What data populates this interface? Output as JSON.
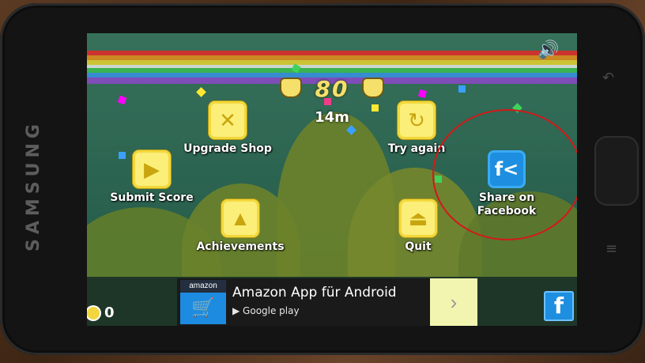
{
  "device": {
    "brand": "SAMSUNG"
  },
  "hud": {
    "score": "80",
    "distance": "14m",
    "coins": "0"
  },
  "menu": {
    "upgrade_shop": "Upgrade Shop",
    "try_again": "Try again",
    "submit_score": "Submit Score",
    "achievements": "Achievements",
    "quit": "Quit",
    "share_facebook": "Share on Facebook"
  },
  "ad": {
    "brand": "amazon",
    "title": "Amazon App für Android",
    "store": "Google play"
  },
  "icons": {
    "upgrade_shop": "wrench-screwdriver-icon",
    "try_again": "restart-icon",
    "submit_score": "submit-icon",
    "achievements": "chart-icon",
    "quit": "exit-icon",
    "share_facebook": "facebook-share-icon",
    "sound": "speaker-icon",
    "coin": "coin-icon",
    "facebook_corner": "facebook-icon"
  },
  "colors": {
    "menu_icon": "#fbef7a",
    "facebook": "#1e8fe0",
    "highlight_circle": "#d41818"
  }
}
